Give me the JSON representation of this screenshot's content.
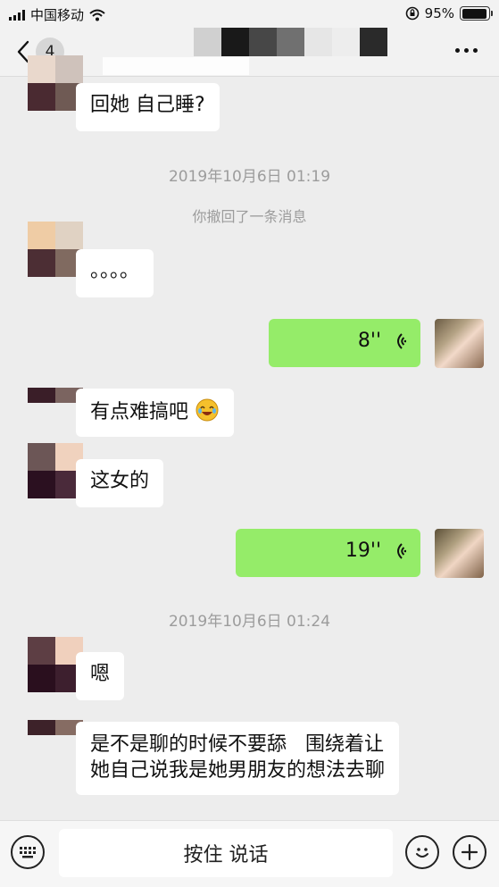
{
  "status_bar": {
    "carrier": "中国移动",
    "battery_percent": "95%",
    "battery_level": 0.95
  },
  "nav": {
    "unread_count": "4",
    "title_redacted_colors": [
      "#d0d0d0",
      "#191919",
      "#474747",
      "#707070",
      "#e6e6e6",
      "#ededed",
      "#2a2a2a"
    ]
  },
  "messages": {
    "m1": {
      "text": "回她 自己睡?"
    },
    "time1": "2019年10月6日 01:19",
    "recall_notice": "你撤回了一条消息",
    "m2": {
      "text": "。。。。"
    },
    "voice1": {
      "duration": "8''"
    },
    "m3": {
      "text": "有点难搞吧"
    },
    "m4": {
      "text": "这女的"
    },
    "voice2": {
      "duration": "19''"
    },
    "time2": "2019年10月6日 01:24",
    "m5": {
      "text": "嗯"
    },
    "m6": {
      "line1": "是不是聊的时候不要舔   围绕着让",
      "line2": "她自己说我是她男朋友的想法去聊"
    }
  },
  "input_bar": {
    "hold_to_talk": "按住 说话"
  },
  "colors": {
    "background": "#ededed",
    "self_bubble": "#95ec69",
    "other_bubble": "#ffffff",
    "timestamp_gray": "#9c9c9c"
  }
}
